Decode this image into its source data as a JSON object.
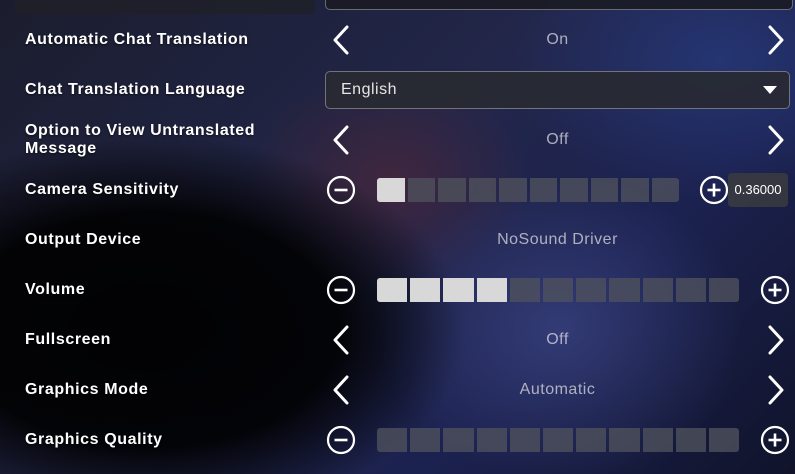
{
  "settings": {
    "chat_translation": {
      "label": "Automatic Chat Translation",
      "value": "On"
    },
    "chat_translation_language": {
      "label": "Chat Translation Language",
      "value": "English"
    },
    "view_untranslated": {
      "label": "Option to View Untranslated Message",
      "value": "Off"
    },
    "camera_sensitivity": {
      "label": "Camera Sensitivity",
      "value": "0.36000",
      "segments_total": 10,
      "segments_on": 1
    },
    "output_device": {
      "label": "Output Device",
      "value": "NoSound Driver"
    },
    "volume": {
      "label": "Volume",
      "segments_total": 11,
      "segments_on": 4
    },
    "fullscreen": {
      "label": "Fullscreen",
      "value": "Off"
    },
    "graphics_mode": {
      "label": "Graphics Mode",
      "value": "Automatic"
    },
    "graphics_quality": {
      "label": "Graphics Quality",
      "segments_total": 11,
      "segments_on": 0
    }
  },
  "icons": {
    "left_arrow": "chevron-left-icon",
    "right_arrow": "chevron-right-icon",
    "minus": "minus-circle-icon",
    "plus": "plus-circle-icon",
    "dropdown_caret": "caret-down-icon"
  },
  "colors": {
    "segment_on": "#d8d8d8",
    "segment_off": "#50525c",
    "value_text": "#dcdce1"
  }
}
